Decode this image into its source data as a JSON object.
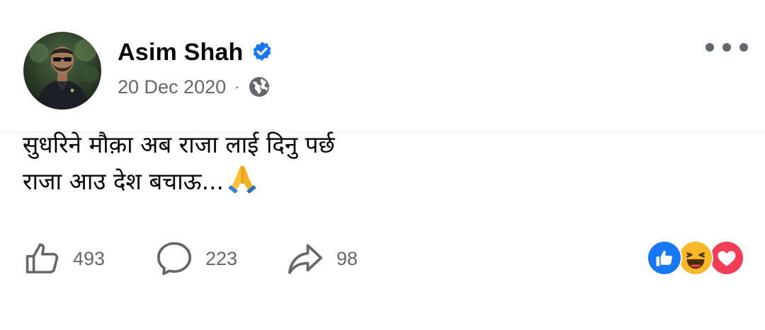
{
  "post": {
    "author": {
      "name": "Asim Shah",
      "verified": true
    },
    "meta": {
      "date": "20 Dec 2020",
      "separator": "·",
      "audience_icon": "globe-icon"
    },
    "text_lines": [
      "सुधरिने मौक़ा अब राजा लाई दिनु पर्छ",
      "राजा आउ देश बचाऊ..."
    ],
    "text_emoji": "folded-hands-emoji",
    "actions": {
      "likes": "493",
      "comments": "223",
      "shares": "98"
    },
    "reactions": [
      "like",
      "haha",
      "love"
    ],
    "colors": {
      "verified": "#1877f2",
      "like_reaction": "#1877f2",
      "love_reaction": "#f33e58",
      "haha_reaction": "#f7b928",
      "secondary_text": "#65676b"
    }
  }
}
